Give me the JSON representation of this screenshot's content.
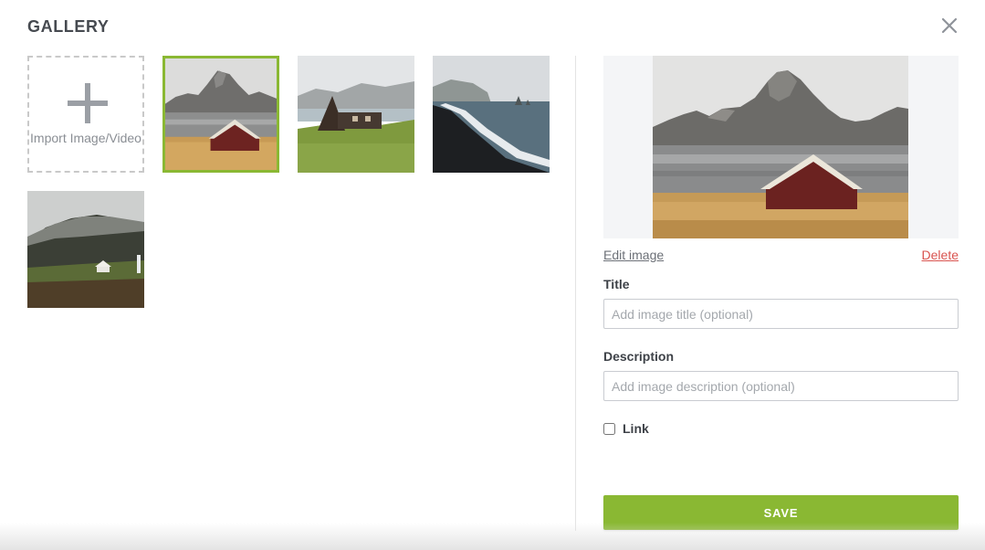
{
  "modal": {
    "title": "GALLERY",
    "close_icon": "close-icon"
  },
  "gallery": {
    "import_label": "Import Image/Video",
    "import_icon": "plus-icon",
    "items": [
      {
        "subject": "red cabin by mountain lake",
        "selected": true
      },
      {
        "subject": "a-frame cabin on green hill",
        "selected": false
      },
      {
        "subject": "black sand beach with sea",
        "selected": false
      },
      {
        "subject": "misty valley with small house",
        "selected": false
      }
    ]
  },
  "details": {
    "edit_label": "Edit image",
    "delete_label": "Delete",
    "title_label": "Title",
    "title_placeholder": "Add image title (optional)",
    "title_value": "",
    "description_label": "Description",
    "description_placeholder": "Add image description (optional)",
    "description_value": "",
    "link_label": "Link",
    "link_checked": false,
    "save_label": "SAVE"
  },
  "colors": {
    "accent": "#8ab833",
    "danger": "#d9534f"
  }
}
